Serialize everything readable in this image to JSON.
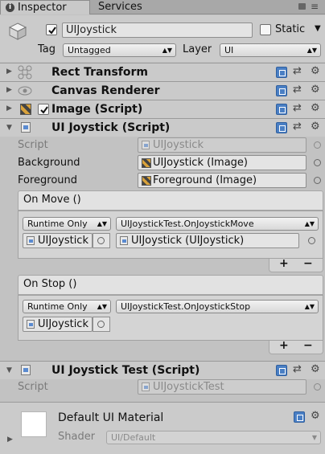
{
  "tabs": [
    {
      "label": "Inspector",
      "icon": "info-icon",
      "active": true
    },
    {
      "label": "Services",
      "active": false
    }
  ],
  "header": {
    "object_name": "UIJoystick",
    "active": true,
    "static_label": "Static",
    "tag_label": "Tag",
    "tag_value": "Untagged",
    "layer_label": "Layer",
    "layer_value": "UI"
  },
  "components": {
    "rect_transform": {
      "title": "Rect Transform"
    },
    "canvas_renderer": {
      "title": "Canvas Renderer"
    },
    "image": {
      "title": "Image (Script)",
      "enabled": true
    },
    "ui_joystick": {
      "title": "UI Joystick (Script)",
      "script_label": "Script",
      "script_value": "UIJoystick",
      "background_label": "Background",
      "background_value": "UIJoystick (Image)",
      "foreground_label": "Foreground",
      "foreground_value": "Foreground (Image)",
      "on_move": {
        "header": "On Move ()",
        "mode": "Runtime Only",
        "function": "UIJoystickTest.OnJoystickMove",
        "target": "UIJoystick",
        "argument": "UIJoystick (UIJoystick)"
      },
      "on_stop": {
        "header": "On Stop ()",
        "mode": "Runtime Only",
        "function": "UIJoystickTest.OnJoystickStop",
        "target": "UIJoystick"
      },
      "plus_label": "+",
      "minus_label": "−"
    },
    "ui_joystick_test": {
      "title": "UI Joystick Test (Script)",
      "script_label": "Script",
      "script_value": "UIJoystickTest"
    }
  },
  "material": {
    "name": "Default UI Material",
    "shader_label": "Shader",
    "shader_value": "UI/Default"
  }
}
